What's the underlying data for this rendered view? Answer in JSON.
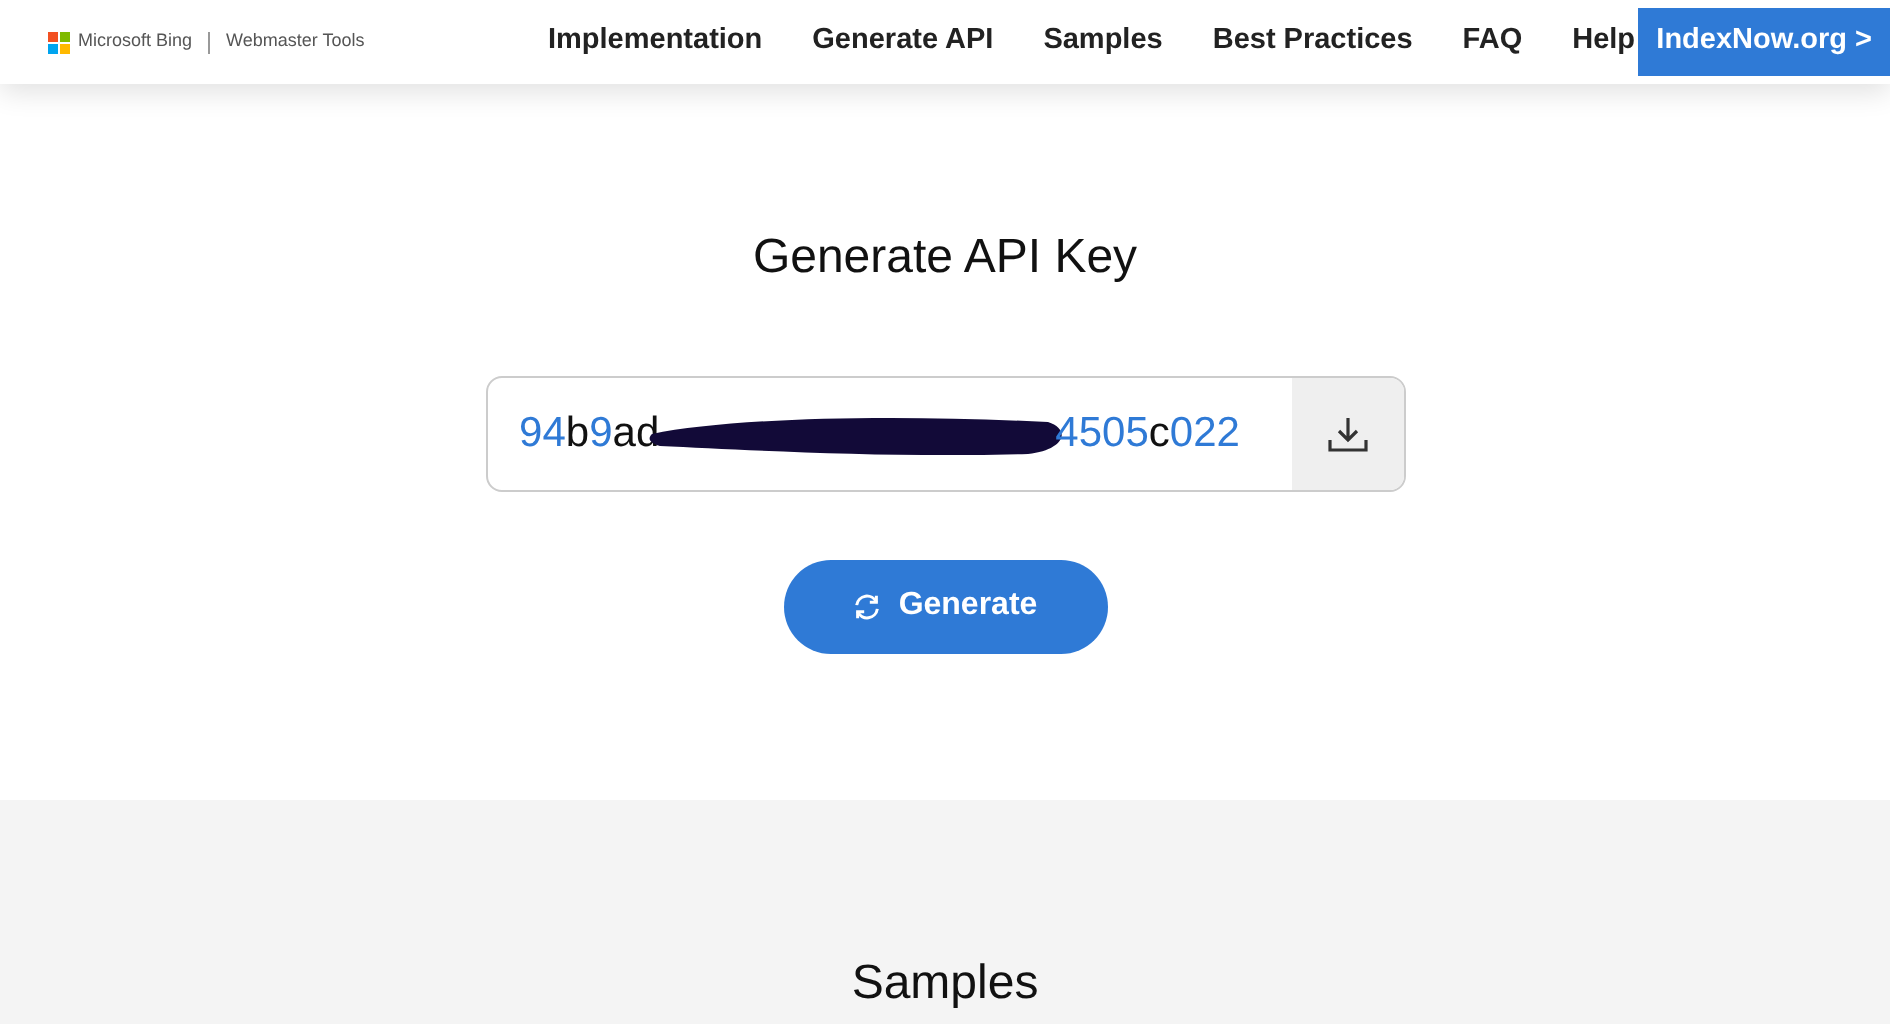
{
  "header": {
    "brand": "Microsoft Bing",
    "product": "Webmaster Tools",
    "nav": [
      {
        "label": "Implementation"
      },
      {
        "label": "Generate API"
      },
      {
        "label": "Samples"
      },
      {
        "label": "Best Practices"
      },
      {
        "label": "FAQ"
      },
      {
        "label": "Help"
      }
    ],
    "cta": "IndexNow.org >"
  },
  "generator": {
    "title": "Generate API Key",
    "key_start": "94b9ad",
    "key_end": "4505c022",
    "redacted": true,
    "button": "Generate"
  },
  "samples": {
    "title": "Samples"
  }
}
